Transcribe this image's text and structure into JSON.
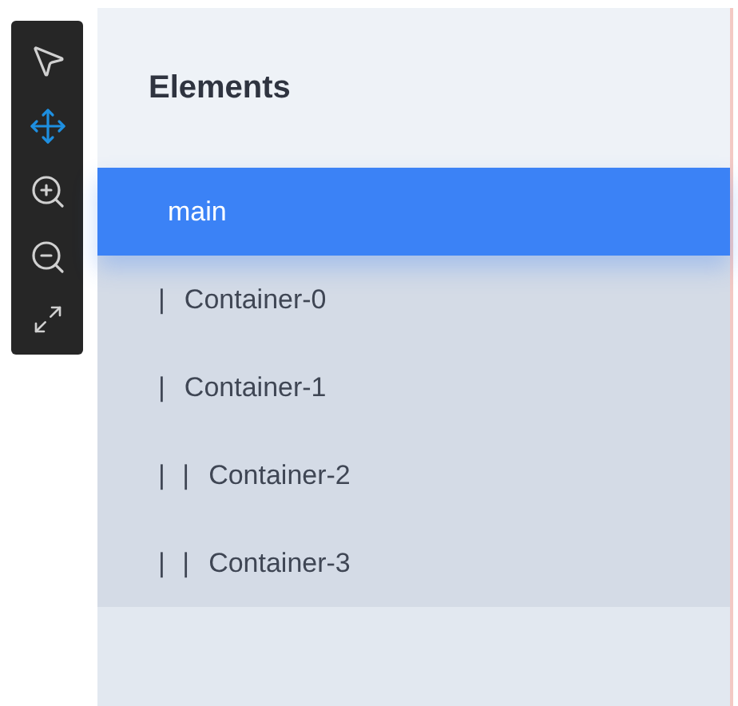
{
  "toolbar": {
    "tools": [
      {
        "kind": "pointer",
        "selected": false
      },
      {
        "kind": "move",
        "selected": true
      },
      {
        "kind": "zoom-in",
        "selected": false
      },
      {
        "kind": "zoom-out",
        "selected": false
      },
      {
        "kind": "fit",
        "selected": false
      }
    ]
  },
  "panel": {
    "title": "Elements",
    "tree": [
      {
        "label": "main",
        "selected": true,
        "children": [
          {
            "prefix": "|",
            "label": "Container-0",
            "selected": false
          },
          {
            "prefix": "|",
            "label": "Container-1",
            "selected": false,
            "children": [
              {
                "prefix": "| |",
                "label": "Container-2",
                "selected": false
              },
              {
                "prefix": "| |",
                "label": "Container-3",
                "selected": false
              }
            ]
          }
        ]
      }
    ]
  }
}
